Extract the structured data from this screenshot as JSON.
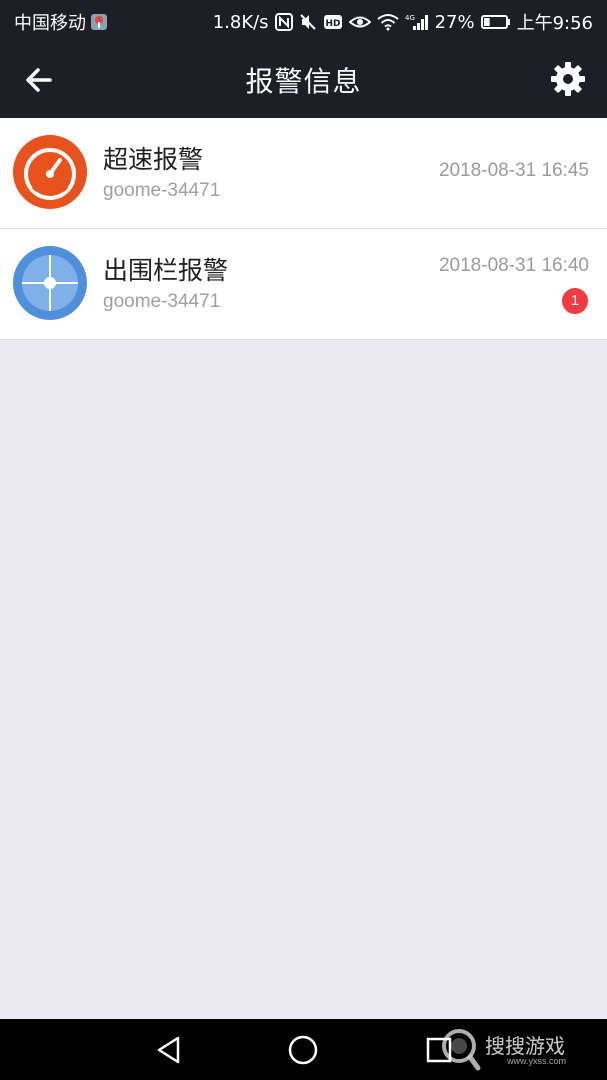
{
  "status_bar": {
    "carrier": "中国移动",
    "speed": "1.8K/s",
    "network": "4G",
    "battery": "27%",
    "time": "上午9:56"
  },
  "app_bar": {
    "title": "报警信息",
    "back_icon": "arrow-left-icon",
    "settings_icon": "gear-icon"
  },
  "alarms": [
    {
      "title": "超速报警",
      "device": "goome-34471",
      "time": "2018-08-31 16:45",
      "icon": "speedometer-icon",
      "icon_color": "#e8521c"
    },
    {
      "title": "出围栏报警",
      "device": "goome-34471",
      "time": "2018-08-31 16:40",
      "icon": "geofence-icon",
      "icon_color": "#4f8fdb",
      "badge": "1"
    }
  ],
  "nav_bar": {
    "back_icon": "triangle-back-icon",
    "home_icon": "circle-home-icon",
    "recents_icon": "square-recents-icon"
  },
  "watermark": {
    "text": "搜搜游戏",
    "url": "www.yxss.com"
  },
  "colors": {
    "bar_bg": "#1c1f25",
    "page_bg": "#ecebf1",
    "badge": "#f23a43"
  }
}
